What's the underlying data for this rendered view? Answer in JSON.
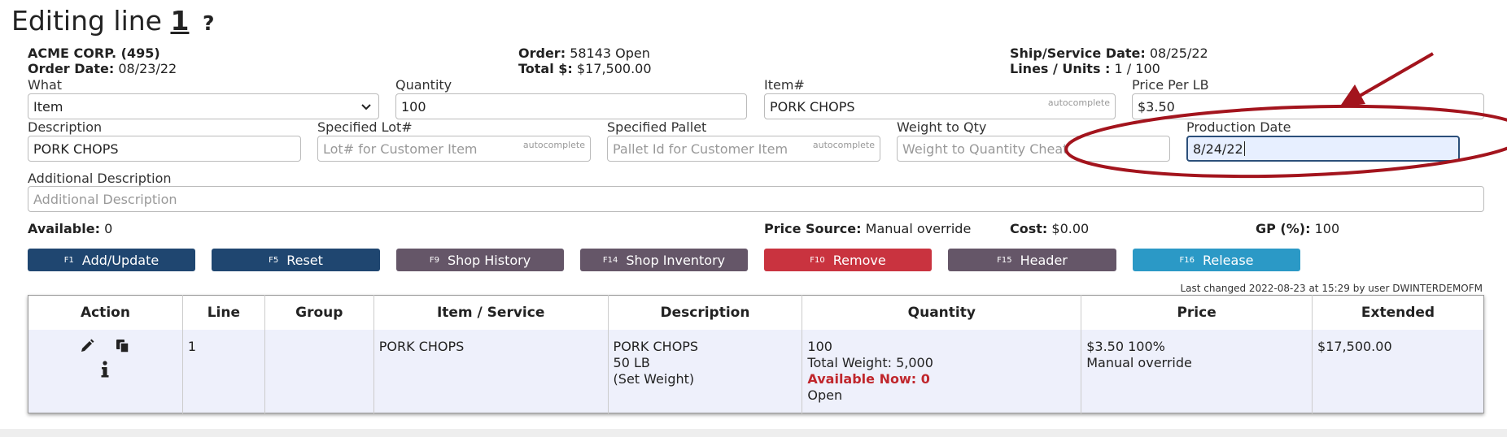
{
  "header": {
    "title_prefix": "Editing line",
    "line_number": "1",
    "help": "?"
  },
  "customer": {
    "name": "ACME CORP. (495)",
    "order_date_label": "Order Date:",
    "order_date": "08/23/22"
  },
  "order": {
    "order_label": "Order:",
    "order_value": "58143 Open",
    "total_label": "Total $:",
    "total_value": "$17,500.00"
  },
  "ship": {
    "ship_label": "Ship/Service Date:",
    "ship_value": "08/25/22",
    "lines_label": "Lines / Units :",
    "lines_value": "1 / 100"
  },
  "fields": {
    "what": {
      "label": "What",
      "value": "Item"
    },
    "quantity": {
      "label": "Quantity",
      "value": "100"
    },
    "item": {
      "label": "Item#",
      "value": "PORK CHOPS",
      "hint": "autocomplete"
    },
    "price": {
      "label": "Price Per LB",
      "value": "$3.50"
    },
    "description": {
      "label": "Description",
      "value": "PORK CHOPS"
    },
    "lot": {
      "label": "Specified Lot#",
      "placeholder": "Lot# for Customer Item",
      "hint": "autocomplete"
    },
    "pallet": {
      "label": "Specified Pallet",
      "placeholder": "Pallet Id for Customer Item",
      "hint": "autocomplete"
    },
    "weight": {
      "label": "Weight to Qty",
      "placeholder": "Weight to Quantity Cheat"
    },
    "production": {
      "label": "Production Date",
      "value": "8/24/22"
    },
    "additional": {
      "label": "Additional Description",
      "placeholder": "Additional Description"
    }
  },
  "summary": {
    "available_label": "Available:",
    "available_value": "0",
    "price_source_label": "Price Source:",
    "price_source_value": "Manual override",
    "cost_label": "Cost:",
    "cost_value": "$0.00",
    "gp_label": "GP (%):",
    "gp_value": "100"
  },
  "buttons": [
    {
      "key": "F1",
      "label": "Add/Update"
    },
    {
      "key": "F5",
      "label": "Reset"
    },
    {
      "key": "F9",
      "label": "Shop History"
    },
    {
      "key": "F14",
      "label": "Shop Inventory"
    },
    {
      "key": "F10",
      "label": "Remove"
    },
    {
      "key": "F15",
      "label": "Header"
    },
    {
      "key": "F16",
      "label": "Release"
    }
  ],
  "last_changed": "Last changed 2022-08-23 at 15:29 by user DWINTERDEMOFM",
  "table": {
    "headers": [
      "Action",
      "Line",
      "Group",
      "Item / Service",
      "Description",
      "Quantity",
      "Price",
      "Extended"
    ],
    "row": {
      "line": "1",
      "group": "",
      "item": "PORK CHOPS",
      "desc1": "PORK CHOPS",
      "desc2": "50 LB",
      "desc3": "(Set Weight)",
      "qty1": "100",
      "qty2": "Total Weight: 5,000",
      "qty3": "Available Now: 0",
      "qty4": "Open",
      "price1": "$3.50 100%",
      "price2": "Manual override",
      "extended": "$17,500.00"
    }
  },
  "colors": {
    "annotation": "#a3141d",
    "navy": "#1f4670",
    "gray": "#655668",
    "red": "#c9333f",
    "blue": "#2b99c6"
  }
}
